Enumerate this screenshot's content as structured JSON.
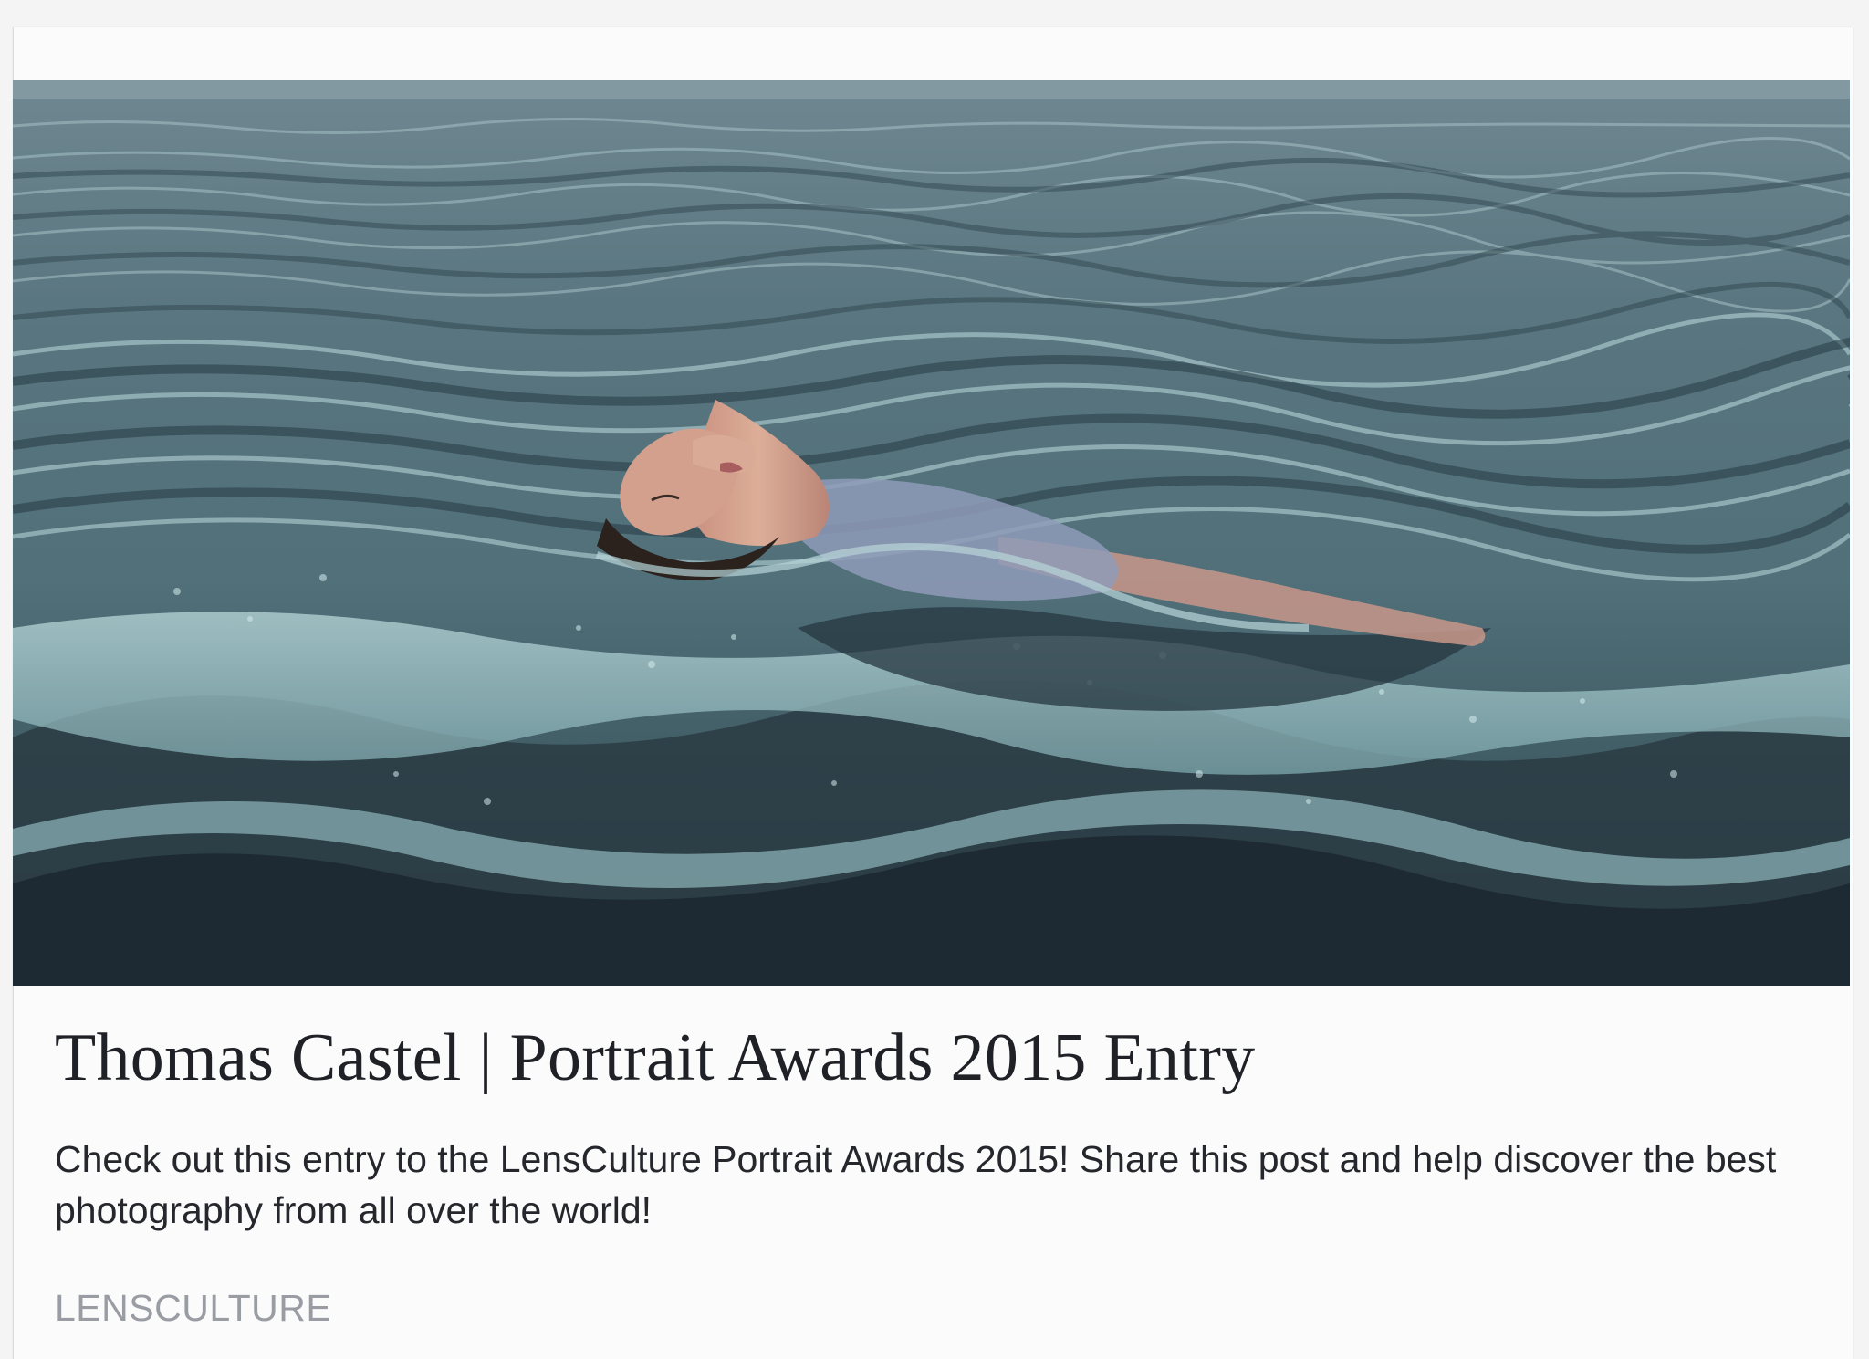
{
  "card": {
    "title": "Thomas Castel | Portrait Awards 2015 Entry",
    "description": "Check out this entry to the LensCulture Portrait Awards 2015! Share this post and help discover the best photography from all over the world!",
    "source": "LENSCULTURE"
  },
  "image": {
    "subject": "woman floating on her back in sea water"
  },
  "colors": {
    "title": "#1f2126",
    "description": "#25272c",
    "source": "#9a9ca3",
    "water_light": "#9fc4c8",
    "water_dark": "#1e2a33"
  }
}
